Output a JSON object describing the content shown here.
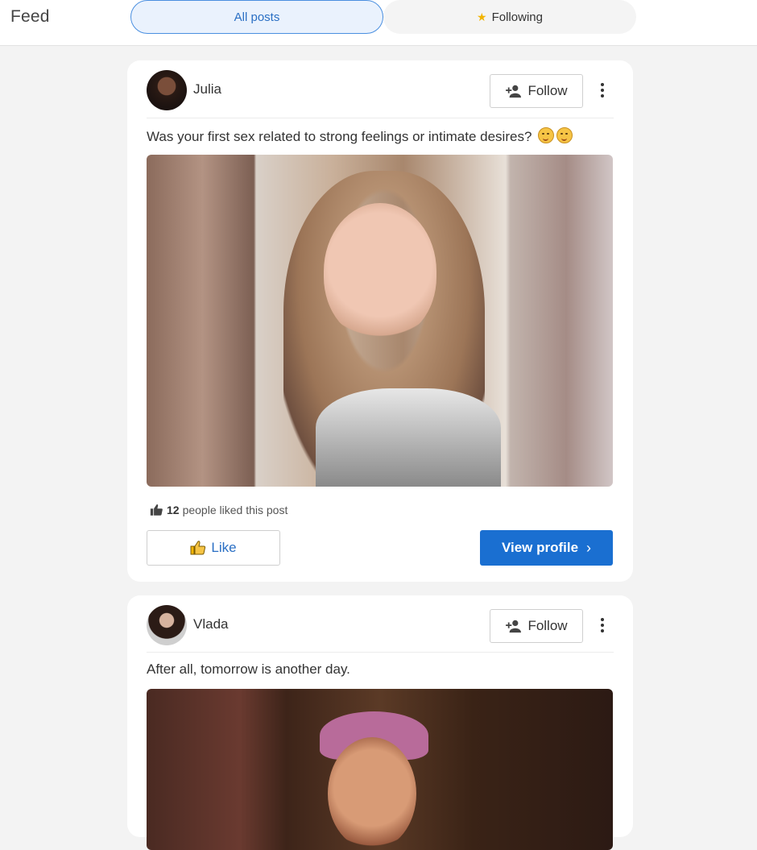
{
  "header": {
    "title": "Feed",
    "tabs": [
      {
        "label": "All posts",
        "active": true
      },
      {
        "label": "Following",
        "icon": "star-icon",
        "active": false
      }
    ]
  },
  "posts": [
    {
      "username": "Julia",
      "follow_label": "Follow",
      "text": "Was your first sex related to strong feelings or intimate desires?",
      "likes_count": "12",
      "likes_suffix": "people liked this post",
      "like_label": "Like",
      "view_profile_label": "View profile"
    },
    {
      "username": "Vlada",
      "follow_label": "Follow",
      "text": "After all, tomorrow is another day."
    }
  ],
  "colors": {
    "accent": "#1a6fd1",
    "tab_active_bg": "#eaf2fd",
    "tab_active_border": "#4a8fe0",
    "background": "#f3f3f3"
  }
}
